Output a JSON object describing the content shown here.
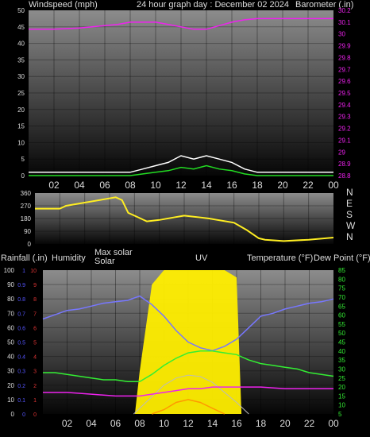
{
  "colors": {
    "background": "#000000",
    "plot_top": "#8c8c8c",
    "plot_bottom": "#050505",
    "wind": "#ffffff",
    "gust_green": "#22dd22",
    "barometer": "#ee22ee",
    "wind_dir": "#ffee22",
    "humidity": "#7777ff",
    "temperature": "#33ee33",
    "dewpoint": "#ee22ee",
    "solar": "#ffee00",
    "uv": "#ff9900",
    "rain_axis": "#5555ff",
    "uv_axis": "#dd3333",
    "text": "#dddddd"
  },
  "chart_data": [
    {
      "type": "line",
      "header": "24 hour graph day : December 02 2024",
      "left_label": "Windspeed (mph)",
      "right_label": "Barometer (.in)",
      "y_left_ticks": [
        "0",
        "5",
        "10",
        "15",
        "20",
        "25",
        "30",
        "35",
        "40",
        "45",
        "50"
      ],
      "y_right_ticks": [
        "28.8",
        "28.9",
        "29",
        "29.1",
        "29.2",
        "29.3",
        "29.4",
        "29.5",
        "29.6",
        "29.7",
        "29.8",
        "29.9",
        "30",
        "30.1",
        "30.2"
      ],
      "x_ticks": [
        "02",
        "04",
        "06",
        "08",
        "10",
        "12",
        "14",
        "16",
        "18",
        "20",
        "22",
        "00"
      ],
      "ylim_left": [
        0,
        50
      ],
      "ylim_right": [
        28.8,
        30.2
      ],
      "xlim": [
        0,
        24
      ],
      "series": [
        {
          "values_x": [
            0,
            2,
            4,
            6,
            7,
            8,
            9,
            10,
            11,
            12,
            13,
            14,
            15,
            16,
            17,
            18,
            19,
            20,
            21,
            22,
            23,
            24
          ],
          "values_y": [
            30.04,
            30.04,
            30.05,
            30.07,
            30.08,
            30.1,
            30.1,
            30.1,
            30.08,
            30.06,
            30.04,
            30.04,
            30.07,
            30.1,
            30.12,
            30.13,
            30.13,
            30.13,
            30.13,
            30.13,
            30.13,
            30.13
          ]
        },
        {
          "values_x": [
            0,
            1,
            2,
            3,
            4,
            5,
            6,
            7,
            8,
            9,
            10,
            11,
            12,
            13,
            14,
            15,
            16,
            17,
            18,
            19,
            20,
            21,
            22,
            23,
            24
          ],
          "values_y": [
            1,
            1,
            1,
            1,
            1,
            1,
            1,
            1,
            1,
            2,
            3,
            4,
            6,
            5,
            6,
            5,
            4,
            2,
            1,
            1,
            1,
            1,
            1,
            1,
            1
          ]
        },
        {
          "values_x": [
            0,
            8,
            9,
            10,
            11,
            12,
            13,
            14,
            15,
            16,
            17,
            18,
            24
          ],
          "values_y": [
            0,
            0,
            0.5,
            1,
            1.5,
            2.5,
            2,
            3,
            2,
            1.5,
            0.5,
            0,
            0
          ]
        }
      ]
    },
    {
      "type": "line",
      "y_ticks": [
        "0",
        "90",
        "180",
        "270",
        "360"
      ],
      "right_labels": [
        "N",
        "W",
        "S",
        "E",
        "N"
      ],
      "ylim": [
        0,
        360
      ],
      "xlim": [
        0,
        24
      ],
      "series": [
        {
          "values_x": [
            0,
            2,
            2.5,
            6.5,
            7,
            7.5,
            8,
            9,
            10,
            12,
            14,
            16,
            17,
            18,
            18.5,
            20,
            22,
            24
          ],
          "values_y": [
            250,
            250,
            270,
            330,
            310,
            220,
            200,
            160,
            170,
            200,
            180,
            150,
            100,
            40,
            30,
            20,
            30,
            45
          ]
        }
      ]
    },
    {
      "type": "line",
      "labels": [
        "Rainfall (.in)",
        "Humidity",
        "Max solar",
        "Solar",
        "UV",
        "Temperature (°F)",
        "Dew Point (°F)"
      ],
      "y_left_ticks": [
        "0",
        "10",
        "20",
        "30",
        "40",
        "50",
        "60",
        "70",
        "80",
        "90",
        "100"
      ],
      "y_rain_ticks": [
        "0",
        "0.1",
        "0.2",
        "0.3",
        "0.4",
        "0.5",
        "0.6",
        "0.7",
        "0.8",
        "0.9",
        "1"
      ],
      "y_uv_ticks": [
        "0",
        "1",
        "2",
        "3",
        "4",
        "5",
        "6",
        "7",
        "8",
        "9",
        "10"
      ],
      "y_right_ticks": [
        "5",
        "10",
        "15",
        "20",
        "25",
        "30",
        "35",
        "40",
        "45",
        "50",
        "55",
        "60",
        "65",
        "70",
        "75",
        "80",
        "85"
      ],
      "x_ticks": [
        "02",
        "04",
        "06",
        "08",
        "10",
        "12",
        "14",
        "16",
        "18",
        "20",
        "22",
        "00"
      ],
      "ylim_left": [
        0,
        100
      ],
      "ylim_right": [
        5,
        85
      ],
      "xlim": [
        0,
        24
      ],
      "series": [
        {
          "values_x": [
            0,
            1,
            2,
            3,
            4,
            5,
            6,
            7,
            8,
            9,
            10,
            11,
            12,
            13,
            14,
            15,
            16,
            17,
            18,
            19,
            20,
            21,
            22,
            23,
            24
          ],
          "values_y": [
            66,
            69,
            72,
            73,
            75,
            77,
            78,
            79,
            82,
            76,
            68,
            58,
            50,
            46,
            44,
            47,
            52,
            60,
            68,
            70,
            73,
            75,
            77,
            78,
            80
          ]
        },
        {
          "values_x": [
            0,
            1,
            2,
            3,
            4,
            5,
            6,
            7,
            8,
            9,
            10,
            11,
            12,
            13,
            14,
            15,
            16,
            17,
            18,
            19,
            20,
            21,
            22,
            23,
            24
          ],
          "values_y": [
            28,
            28,
            27,
            26,
            25,
            24,
            24,
            23,
            23,
            27,
            32,
            36,
            39,
            40,
            40,
            39,
            38,
            35,
            33,
            32,
            31,
            30,
            28,
            27,
            26
          ]
        },
        {
          "values_x": [
            0,
            2,
            4,
            6,
            7,
            8,
            9,
            10,
            11,
            12,
            13,
            14,
            15,
            16,
            17,
            18,
            20,
            22,
            24
          ],
          "values_y": [
            17,
            17,
            16,
            15,
            15,
            15,
            16,
            17,
            18,
            19,
            19,
            20,
            20,
            20,
            20,
            20,
            19,
            19,
            19
          ]
        },
        {
          "values_x": [
            7.6,
            8,
            9,
            10,
            11,
            12,
            13,
            14,
            15,
            16,
            16.4
          ],
          "values_y": [
            0,
            30,
            90,
            100,
            100,
            100,
            100,
            100,
            100,
            95,
            0
          ]
        },
        {
          "values_x": [
            7.5,
            9,
            10,
            11,
            12,
            13,
            14,
            15,
            16,
            17
          ],
          "values_y": [
            0,
            12,
            20,
            25,
            27,
            26,
            22,
            15,
            8,
            0
          ]
        },
        {
          "values_x": [
            9,
            10,
            11,
            12,
            13,
            14,
            15
          ],
          "values_y": [
            0,
            0.3,
            0.8,
            1.0,
            0.8,
            0.4,
            0
          ]
        }
      ]
    }
  ]
}
